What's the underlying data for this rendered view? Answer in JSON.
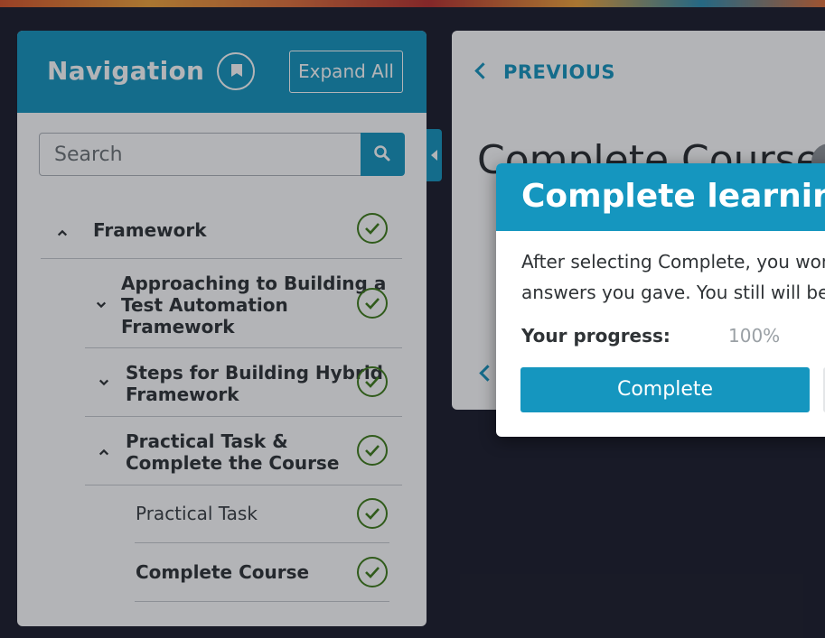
{
  "nav": {
    "title": "Navigation",
    "expand_all_label": "Expand All",
    "search_placeholder": "Search",
    "items": [
      {
        "label": "Framework",
        "expanded": true,
        "completed": true
      },
      {
        "label": "Approaching to Building a Test Automation Framework",
        "line1": "Approaching to Building a",
        "line2": "Test Automation",
        "line3": "Framework",
        "expanded": false,
        "completed": true
      },
      {
        "label": "Steps for Building Hybrid Framework",
        "line1": "Steps for Building Hybrid",
        "line2": "Framework",
        "expanded": false,
        "completed": true
      },
      {
        "label": "Practical Task & Complete the Course",
        "line1": "Practical Task &",
        "line2": "Complete the Course",
        "expanded": true,
        "completed": true
      },
      {
        "label": "Practical Task",
        "completed": true
      },
      {
        "label": "Complete Course",
        "completed": true
      }
    ]
  },
  "content": {
    "previous_label": "PREVIOUS",
    "title": "Complete Course"
  },
  "modal": {
    "title": "Complete learning",
    "body_line1": "After selecting Complete, you won",
    "body_line2": "answers you gave. You still will be",
    "progress_label": "Your progress:",
    "progress_value": "100%",
    "complete_label": "Complete"
  },
  "colors": {
    "accent": "#1596bf",
    "check_green": "#3f7d1a",
    "background": "#1b1d2b"
  }
}
